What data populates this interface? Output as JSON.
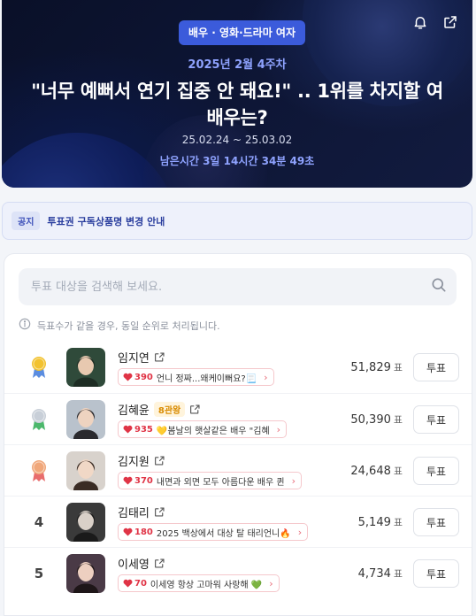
{
  "hero": {
    "category": "배우 · 영화·드라마 여자",
    "week": "2025년 2월 4주차",
    "title": "\"너무 예뻐서 연기 집중 안 돼요!\" .. 1위를 차지할 여배우는?",
    "period": "25.02.24 ~ 25.03.02",
    "remaining": "남은시간 3일 14시간 34분 49초",
    "icons": [
      "bell-icon",
      "share-icon"
    ]
  },
  "notice": {
    "tag": "공지",
    "text": "투표권 구독상품명 변경 안내"
  },
  "search": {
    "placeholder": "투표 대상을 검색해 보세요.",
    "icon": "search-icon"
  },
  "info_text": "득표수가 같을 경우, 동일 순위로 처리됩니다.",
  "vote_unit": "표",
  "vote_button": "투표",
  "colors": {
    "accent": "#3b5bdb",
    "heart": "#e03446",
    "gold": "#f2c230",
    "silver": "#c8cfd8",
    "bronze": "#f0a77a"
  },
  "candidates": [
    {
      "rank": "1",
      "medal": "gold",
      "name": "임지연",
      "flag": "",
      "cheer_count": "390",
      "cheer_msg": "언니 정짜...왜케이뻐요?📃",
      "votes": "51,829"
    },
    {
      "rank": "2",
      "medal": "silver",
      "name": "김혜윤",
      "flag": "8관왕",
      "cheer_count": "935",
      "cheer_msg": "💛봄날의 햇살같은 배우 \"김혜",
      "votes": "50,390"
    },
    {
      "rank": "3",
      "medal": "bronze",
      "name": "김지원",
      "flag": "",
      "cheer_count": "370",
      "cheer_msg": "내면과 외면 모두 아름다운 배우 퀸",
      "votes": "24,648"
    },
    {
      "rank": "4",
      "medal": "",
      "name": "김태리",
      "flag": "",
      "cheer_count": "180",
      "cheer_msg": "2025 백상에서 대상 탈 태리언니🔥",
      "votes": "5,149"
    },
    {
      "rank": "5",
      "medal": "",
      "name": "이세영",
      "flag": "",
      "cheer_count": "70",
      "cheer_msg": "이세영 항상 고마워 사랑해 💚",
      "votes": "4,734"
    }
  ]
}
